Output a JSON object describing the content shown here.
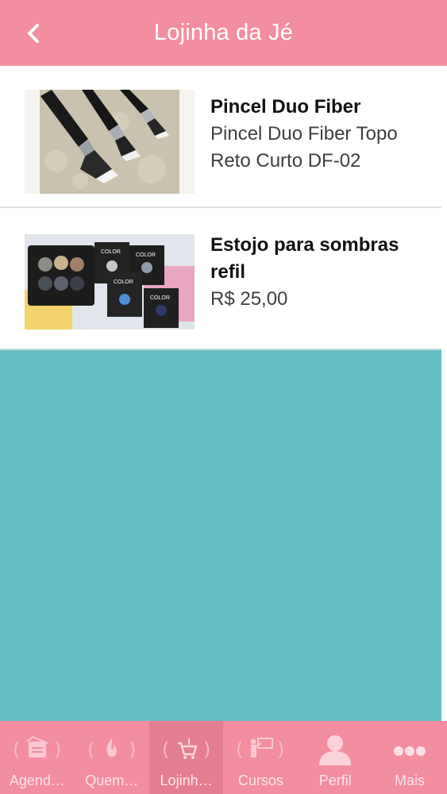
{
  "header": {
    "title": "Lojinha da Jé",
    "back_icon": "chevron-left-icon"
  },
  "products": [
    {
      "title": "Pincel Duo Fiber",
      "subtitle": "Pincel Duo Fiber Topo Reto Curto DF-02"
    },
    {
      "title": "Estojo para sombras refil",
      "subtitle": "R$ 25,00"
    }
  ],
  "tabbar": {
    "tabs": [
      {
        "label": "Agend…",
        "icon": "calendar-icon"
      },
      {
        "label": "Quem…",
        "icon": "fire-icon"
      },
      {
        "label": "Lojinh…",
        "icon": "cart-icon",
        "active": true
      },
      {
        "label": "Cursos",
        "icon": "presentation-icon"
      },
      {
        "label": "Perfil",
        "icon": "person-icon"
      },
      {
        "label": "Mais",
        "icon": "more-icon"
      }
    ]
  },
  "colors": {
    "header": "#f28ea0",
    "content_bg": "#63bfc3",
    "tab_active": "#e57d90"
  }
}
